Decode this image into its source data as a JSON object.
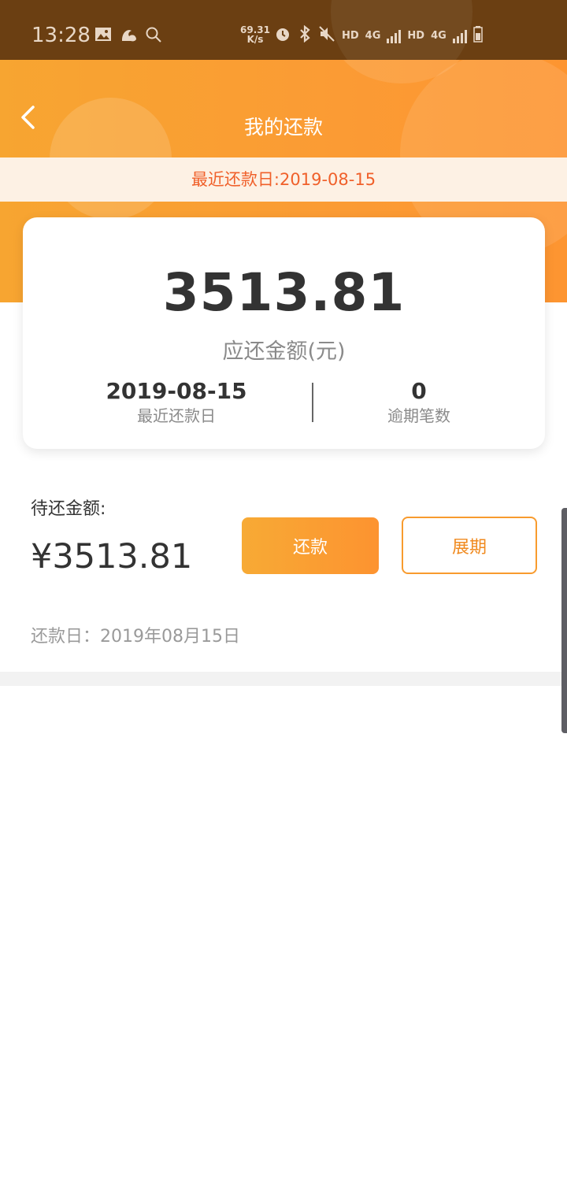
{
  "status_bar": {
    "time": "13:28",
    "speed_value": "69.31",
    "speed_unit": "K/s",
    "indicators": [
      "HD",
      "4G",
      "HD",
      "4G"
    ],
    "icons": [
      "image-icon",
      "uc-browser-icon",
      "search-icon",
      "alarm-icon",
      "bluetooth-icon",
      "mute-icon",
      "signal-icon",
      "battery-icon"
    ]
  },
  "header": {
    "title": "我的还款",
    "back_icon": "chevron-left-icon"
  },
  "notice": {
    "text": "最近还款日:2019-08-15"
  },
  "summary": {
    "amount": "3513.81",
    "amount_label": "应还金额(元)",
    "recent_date": "2019-08-15",
    "recent_date_label": "最近还款日",
    "overdue_count": "0",
    "overdue_label": "逾期笔数"
  },
  "bill": {
    "pending_label": "待还金额:",
    "pending_amount": "¥3513.81",
    "repay_button": "还款",
    "extend_button": "展期",
    "due_line": "还款日：2019年08月15日"
  },
  "colors": {
    "accent": "#fb9b34",
    "notice_text": "#f0602a",
    "status_bar": "#6b3f12"
  }
}
